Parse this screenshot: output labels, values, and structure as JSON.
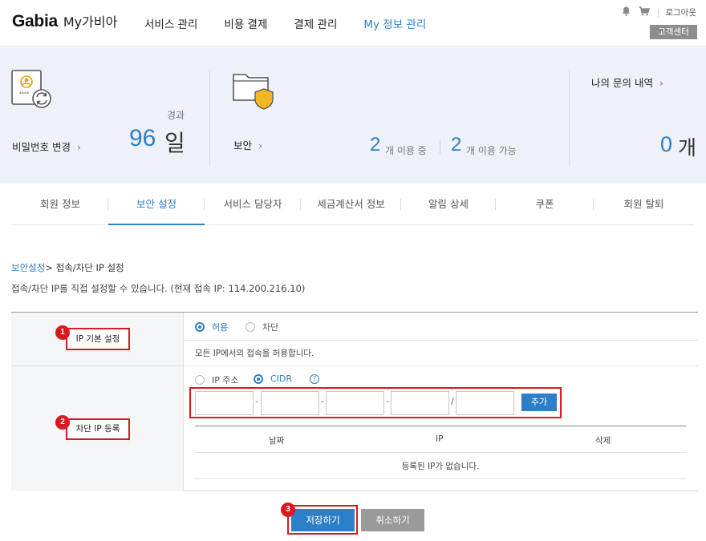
{
  "header": {
    "logo_brand": "Gabia",
    "logo_sub": "My가비아",
    "nav": [
      {
        "label": "서비스 관리"
      },
      {
        "label": "비용 결제"
      },
      {
        "label": "결제 관리"
      },
      {
        "label": "My 정보 관리",
        "active": true
      }
    ],
    "logout": "로그아웃",
    "customer_center": "고객센터"
  },
  "summary": {
    "password": {
      "label": "비밀번호 변경",
      "elapsed_label": "경과",
      "days": "96",
      "unit": "일"
    },
    "security": {
      "label": "보안",
      "in_use_count": "2",
      "in_use_text": "개 이용 중",
      "available_count": "2",
      "available_text": "개 이용 가능"
    },
    "inquiry": {
      "label": "나의 문의 내역",
      "count": "0",
      "unit": "개"
    }
  },
  "tabs": [
    {
      "label": "회원 정보"
    },
    {
      "label": "보안 설정",
      "active": true
    },
    {
      "label": "서비스 담당자"
    },
    {
      "label": "세금계산서 정보"
    },
    {
      "label": "알림 상세"
    },
    {
      "label": "쿠폰"
    },
    {
      "label": "회원 탈퇴"
    }
  ],
  "content": {
    "breadcrumb_link": "보안설정",
    "breadcrumb_current": "> 접속/차단 IP 설정",
    "description": "접속/차단 IP를 직접 설정할 수 있습니다. (현재 접속 IP: 114.200.216.10)",
    "row1": {
      "label": "IP 기본 설정",
      "badge": "1",
      "options": [
        {
          "label": "허용",
          "selected": true
        },
        {
          "label": "차단",
          "selected": false
        }
      ],
      "note": "모든 IP에서의 접속을 허용합니다."
    },
    "row2": {
      "label": "차단 IP 등록",
      "badge": "2",
      "options": [
        {
          "label": "IP 주소",
          "selected": false
        },
        {
          "label": "CIDR",
          "selected": true
        }
      ],
      "help": "?",
      "ip_separators": [
        "-",
        "-",
        "-",
        "/"
      ],
      "add_button": "추가",
      "columns": [
        "날짜",
        "IP",
        "삭제"
      ],
      "empty": "등록된 IP가 없습니다."
    },
    "save_badge": "3",
    "save_button": "저장하기",
    "cancel_button": "취소하기"
  },
  "colors": {
    "accent": "#2d7fc7",
    "annotation": "#d8191f",
    "band": "#eef2f8"
  }
}
